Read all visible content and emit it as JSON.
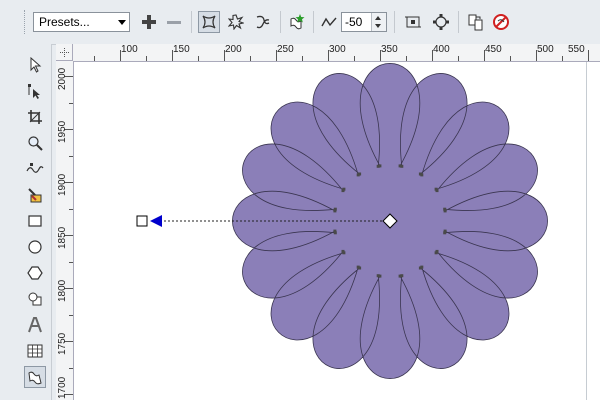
{
  "toolbar": {
    "presets_label": "Presets...",
    "add_preset_icon": "plus-icon",
    "remove_preset_icon": "minus-icon",
    "transformation_value": "-50",
    "colors": {
      "accent_green": "#2a9d2a",
      "accent_red": "#d02020"
    }
  },
  "toolbox": {
    "tools": [
      "pick-tool-icon",
      "shape-tool-icon",
      "crop-tool-icon",
      "zoom-tool-icon",
      "freehand-tool-icon",
      "smart-fill-tool-icon",
      "rectangle-tool-icon",
      "ellipse-tool-icon",
      "polygon-tool-icon",
      "basic-shapes-tool-icon",
      "text-tool-icon",
      "table-tool-icon",
      "distort-tool-icon"
    ]
  },
  "ruler": {
    "h_labels": [
      "100",
      "150",
      "200",
      "250",
      "300",
      "350",
      "400",
      "450",
      "500",
      "550"
    ],
    "v_labels": [
      "2000",
      "1950",
      "1900",
      "1850",
      "1800",
      "1750",
      "1700"
    ]
  },
  "canvas": {
    "flower_color": "#8b7fb8",
    "outline_color": "#3a3550",
    "vector_color": "#0000cc"
  }
}
